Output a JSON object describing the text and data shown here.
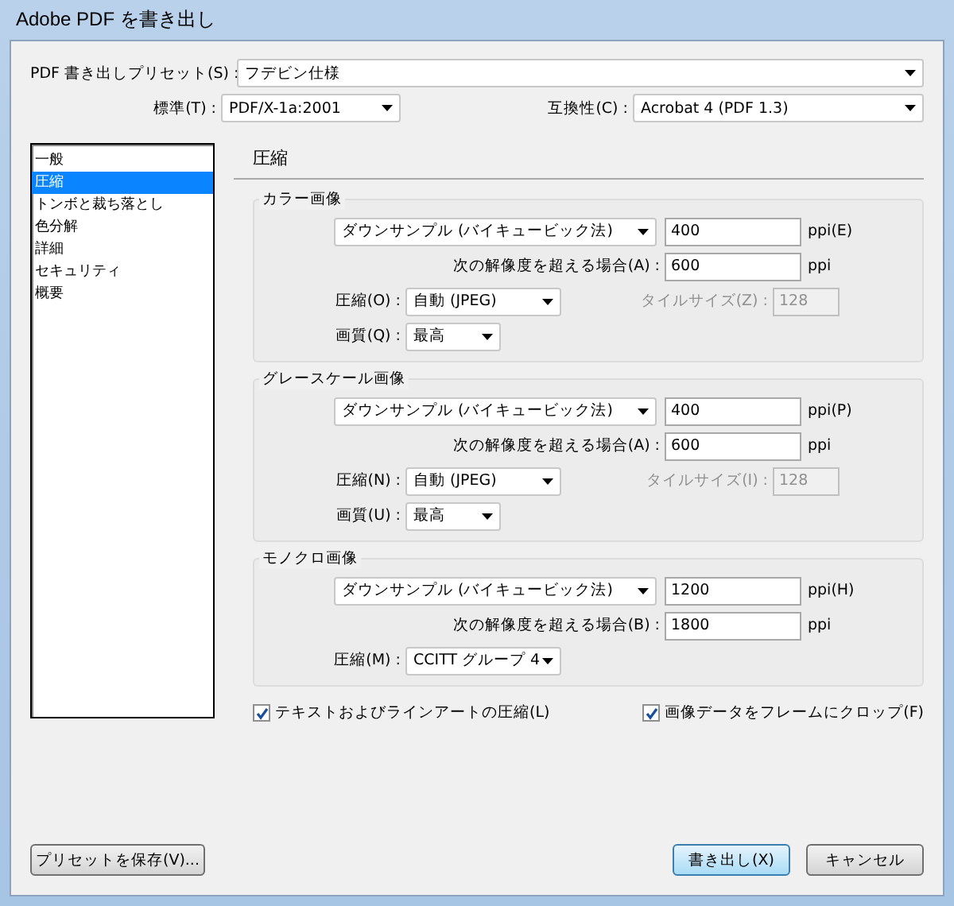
{
  "window": {
    "title": "Adobe PDF を書き出し"
  },
  "preset": {
    "label": "PDF 書き出しプリセット(S) :",
    "value": "フデビン仕様"
  },
  "standard": {
    "label": "標準(T) :",
    "value": "PDF/X-1a:2001"
  },
  "compatibility": {
    "label": "互換性(C) :",
    "value": "Acrobat 4 (PDF 1.3)"
  },
  "sidebar": {
    "items": [
      {
        "label": "一般",
        "selected": false
      },
      {
        "label": "圧縮",
        "selected": true
      },
      {
        "label": "トンボと裁ち落とし",
        "selected": false
      },
      {
        "label": "色分解",
        "selected": false
      },
      {
        "label": "詳細",
        "selected": false
      },
      {
        "label": "セキュリティ",
        "selected": false
      },
      {
        "label": "概要",
        "selected": false
      }
    ]
  },
  "panel": {
    "title": "圧縮",
    "sections": [
      {
        "title": "カラー画像",
        "downsample": "ダウンサンプル (バイキュービック法)",
        "resolution": {
          "value": "400",
          "unit": "ppi(E)"
        },
        "threshold": {
          "label": "次の解像度を超える場合(A) :",
          "value": "600",
          "unit": "ppi"
        },
        "compression": {
          "label": "圧縮(O) :",
          "value": "自動 (JPEG)"
        },
        "tile_size": {
          "label": "タイルサイズ(Z) :",
          "value": "128",
          "disabled": true
        },
        "quality": {
          "label": "画質(Q) :",
          "value": "最高"
        }
      },
      {
        "title": "グレースケール画像",
        "downsample": "ダウンサンプル (バイキュービック法)",
        "resolution": {
          "value": "400",
          "unit": "ppi(P)"
        },
        "threshold": {
          "label": "次の解像度を超える場合(A) :",
          "value": "600",
          "unit": "ppi"
        },
        "compression": {
          "label": "圧縮(N) :",
          "value": "自動 (JPEG)"
        },
        "tile_size": {
          "label": "タイルサイズ(I) :",
          "value": "128",
          "disabled": true
        },
        "quality": {
          "label": "画質(U) :",
          "value": "最高"
        }
      },
      {
        "title": "モノクロ画像",
        "downsample": "ダウンサンプル (バイキュービック法)",
        "resolution": {
          "value": "1200",
          "unit": "ppi(H)"
        },
        "threshold": {
          "label": "次の解像度を超える場合(B) :",
          "value": "1800",
          "unit": "ppi"
        },
        "compression": {
          "label": "圧縮(M) :",
          "value": "CCITT グループ 4"
        }
      }
    ],
    "options": [
      {
        "label": "テキストおよびラインアートの圧縮(L)",
        "checked": true
      },
      {
        "label": "画像データをフレームにクロップ(F)",
        "checked": true
      }
    ]
  },
  "buttons": {
    "save_preset": "プリセットを保存(V)...",
    "export": "書き出し(X)",
    "cancel": "キャンセル"
  }
}
